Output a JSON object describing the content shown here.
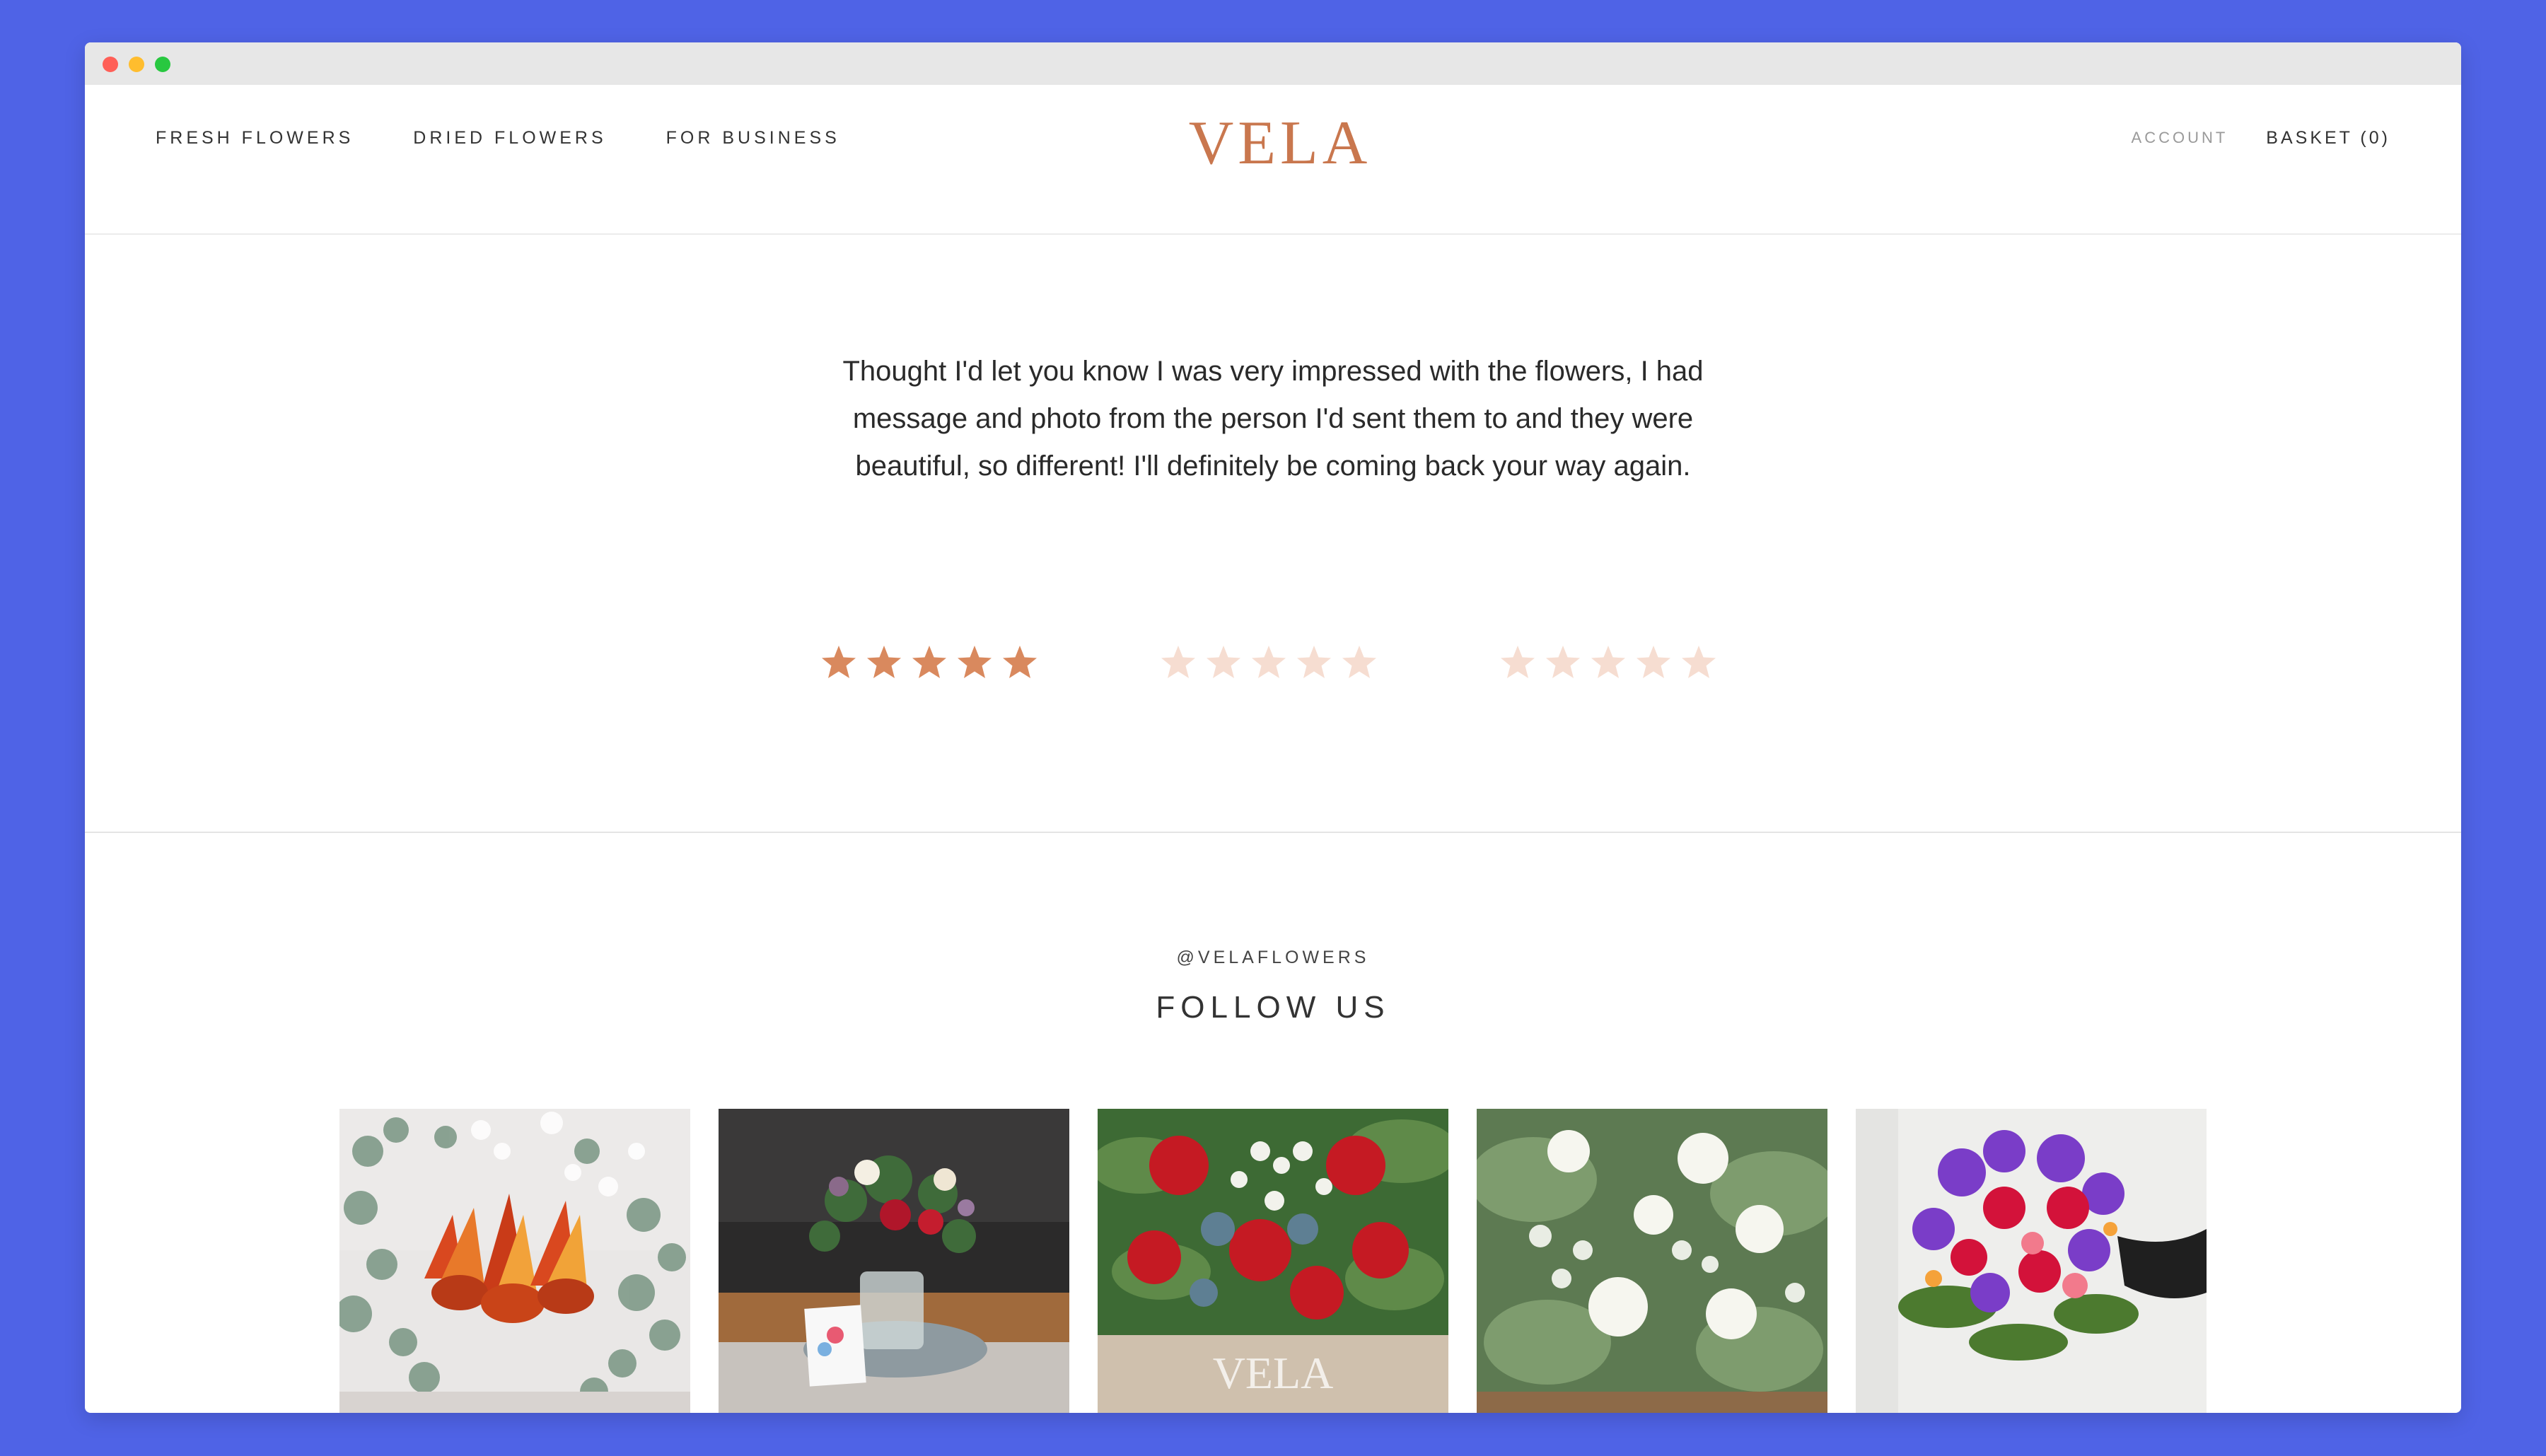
{
  "nav": {
    "left_items": [
      "FRESH FLOWERS",
      "DRIED FLOWERS",
      "FOR BUSINESS"
    ],
    "logo": "VELA",
    "account": "ACCOUNT",
    "basket": "BASKET (0)"
  },
  "testimonial": {
    "quote": "Thought I'd let you know I was very impressed with the flowers, I had message and photo from the person I'd sent them to and they were beautiful,  so different! I'll definitely be coming back your way again.",
    "ratings": [
      {
        "stars": 5,
        "active": true
      },
      {
        "stars": 5,
        "active": false
      },
      {
        "stars": 5,
        "active": false
      }
    ]
  },
  "social": {
    "handle": "@VELAFLOWERS",
    "heading": "FOLLOW US",
    "photos": [
      "protea-eucalyptus",
      "jar-bouquet-card",
      "red-rose-box",
      "white-rose-bouquet",
      "purple-red-bouquet"
    ]
  },
  "colors": {
    "brand": "#c9774e",
    "star_active": "#d9895e",
    "star_inactive": "#f6ddd1",
    "background": "#4f63e6"
  }
}
